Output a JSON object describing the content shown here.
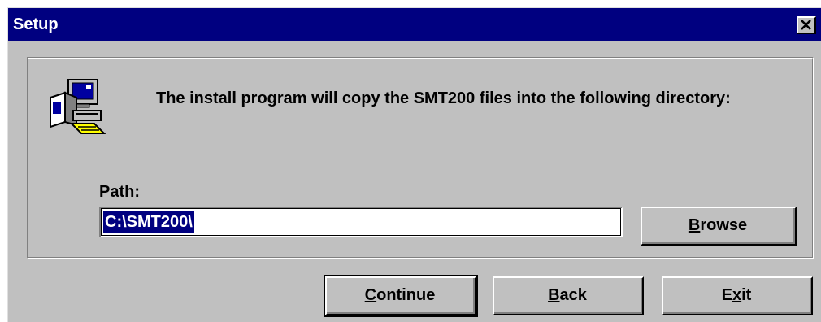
{
  "window": {
    "title": "Setup",
    "close_icon": "close-icon"
  },
  "content": {
    "icon": "setup-computer-icon",
    "message": "The install program will copy the SMT200 files into the following directory:",
    "path_label": "Path:",
    "path_value": "C:\\SMT200\\"
  },
  "buttons": {
    "browse": {
      "prefix": "",
      "mnemonic": "B",
      "suffix": "rowse"
    },
    "continue": {
      "prefix": "",
      "mnemonic": "C",
      "suffix": "ontinue"
    },
    "back": {
      "prefix": "",
      "mnemonic": "B",
      "suffix": "ack"
    },
    "exit": {
      "prefix": "E",
      "mnemonic": "x",
      "suffix": "it"
    }
  },
  "colors": {
    "titlebar": "#000080",
    "face": "#c0c0c0",
    "selection": "#000080"
  }
}
